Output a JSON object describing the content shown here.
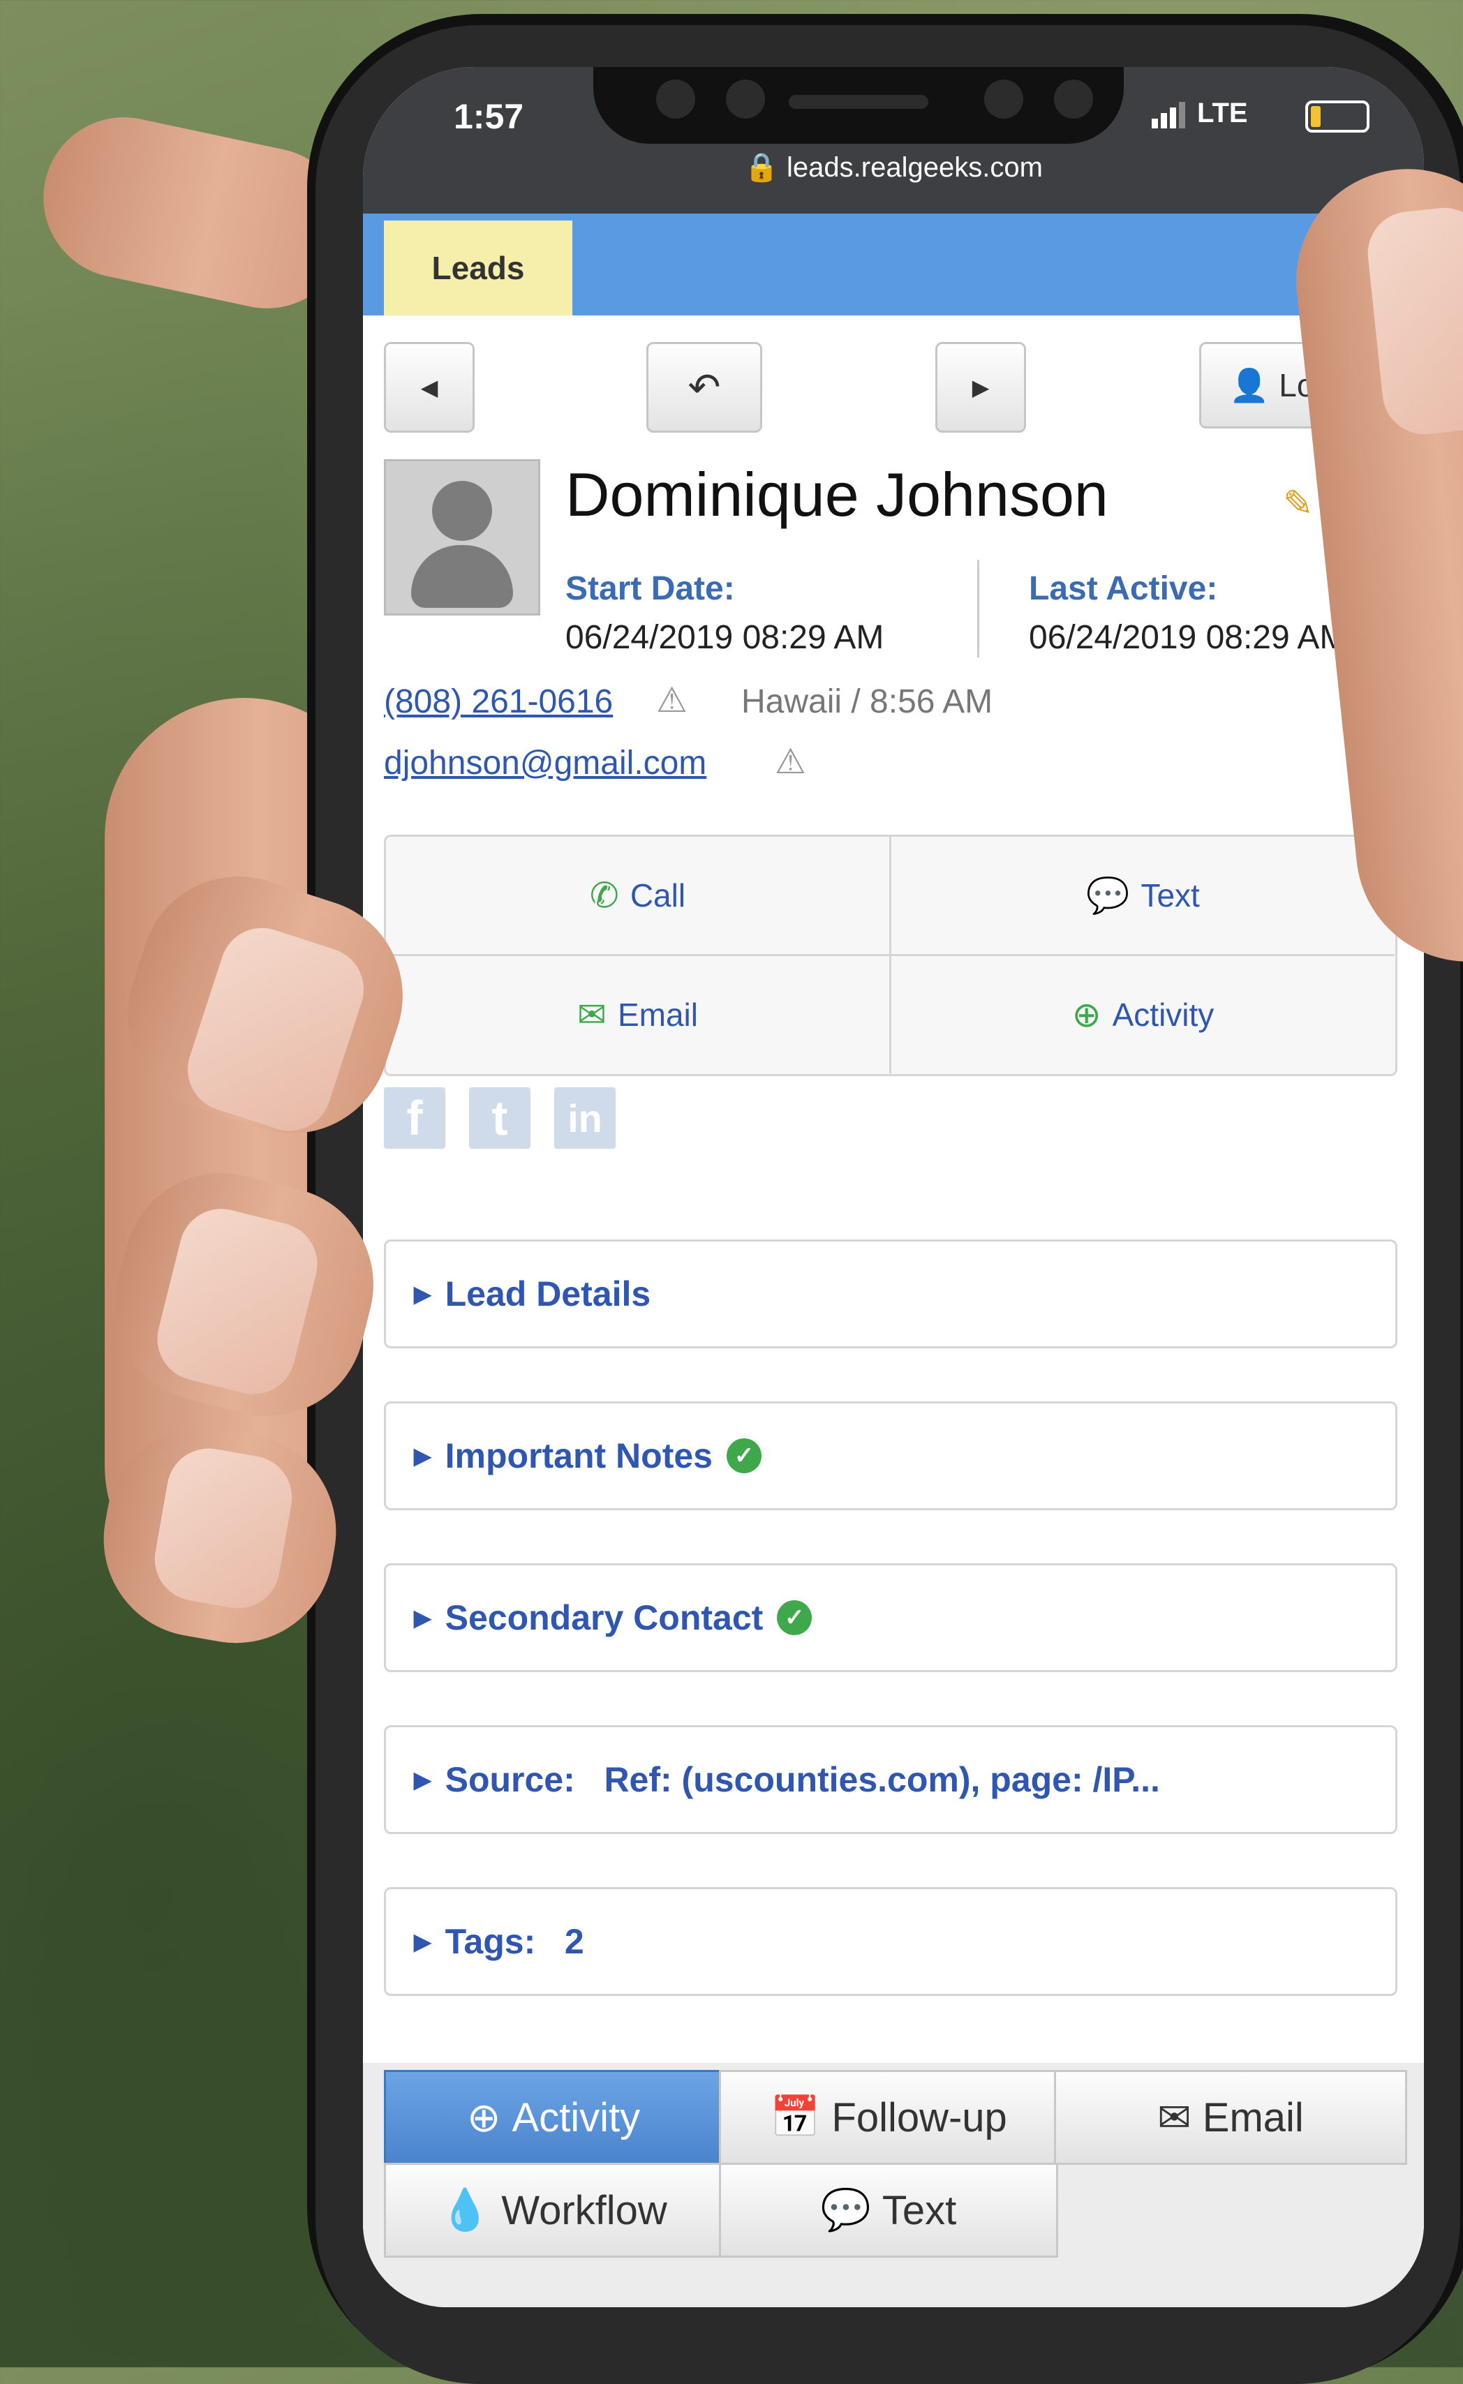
{
  "status_bar": {
    "time": "1:57",
    "network": "LTE",
    "url": "leads.realgeeks.com"
  },
  "navbar": {
    "tab": "Leads"
  },
  "toolbar": {
    "login_label": "Logi"
  },
  "lead": {
    "name": "Dominique Johnson",
    "edit_label": "E",
    "start_date_label": "Start Date:",
    "start_date": "06/24/2019 08:29 AM",
    "last_active_label": "Last Active:",
    "last_active": "06/24/2019 08:29 AM",
    "phone": "(808) 261-0616",
    "location": "Hawaii / 8:56 AM",
    "email": "djohnson@gmail.com"
  },
  "actions": {
    "call": "Call",
    "text": "Text",
    "email": "Email",
    "activity": "Activity"
  },
  "social": {
    "facebook": "f",
    "twitter": "t",
    "linkedin": "in"
  },
  "panels": {
    "lead_details": "Lead Details",
    "important_notes": "Important Notes",
    "secondary_contact": "Secondary Contact",
    "source": "Source:   Ref: (uscounties.com), page: /IP...",
    "tags": "Tags:   2"
  },
  "bottom_tabs": {
    "activity": "Activity",
    "followup": "Follow-up",
    "email": "Email",
    "workflow": "Workflow",
    "text": "Text"
  },
  "colors": {
    "accent": "#5a9ae3",
    "leads_tab": "#f6efac",
    "link": "#2f56b0",
    "success": "#3ea84a"
  }
}
